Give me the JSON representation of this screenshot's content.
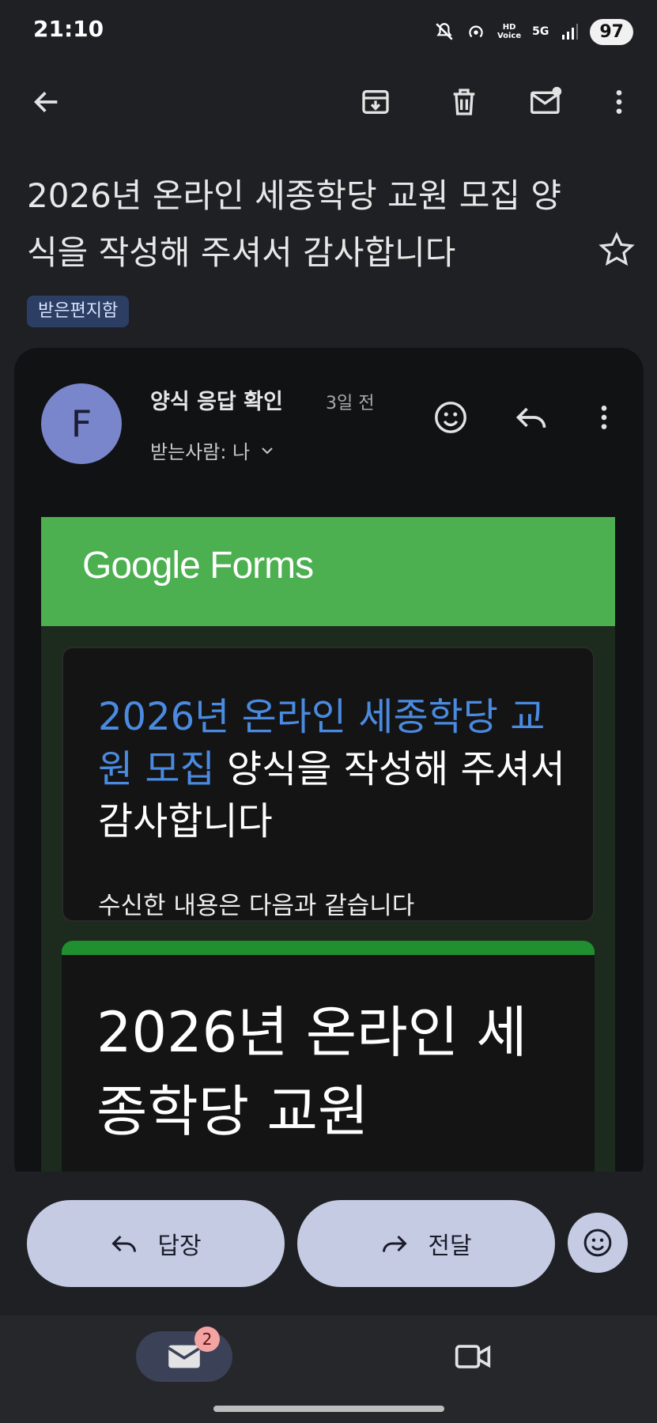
{
  "status_bar": {
    "time": "21:10",
    "hd_label": "HD\nVoice",
    "network_label": "5G",
    "battery": "97",
    "icons": [
      "mute-icon",
      "hotspot-icon",
      "hd-voice-icon",
      "5g-icon",
      "signal-icon",
      "battery-icon"
    ]
  },
  "toolbar": {
    "icons": [
      "back-arrow-icon",
      "archive-icon",
      "delete-icon",
      "mark-unread-icon",
      "more-vert-icon"
    ]
  },
  "email": {
    "subject": "2026년 온라인 세종학당 교원 모집 양식을 작성해 주셔서 감사합니다",
    "label": "받은편지함",
    "sender_initial": "F",
    "sender_name": "양식 응답 확인",
    "time_ago": "3일 전",
    "recipient": "받는사람: 나"
  },
  "forms": {
    "logo": "Google Forms",
    "title_link": "2026년 온라인 세종학당 교원 모집",
    "title_rest": " 양식을 작성해 주셔서 감사합니다",
    "subtitle": "수신한 내용은 다음과 같습니다",
    "big_title": "2026년 온라인 세종학당 교원"
  },
  "actions": {
    "reply": "답장",
    "forward": "전달"
  },
  "navbar": {
    "mail_badge": "2"
  },
  "colors": {
    "background": "#1f2023",
    "card": "#111214",
    "forms_green": "#4caf50",
    "link_blue": "#4a8ae0",
    "pill": "#c5cbe3",
    "label_chip": "#2c3e64"
  }
}
